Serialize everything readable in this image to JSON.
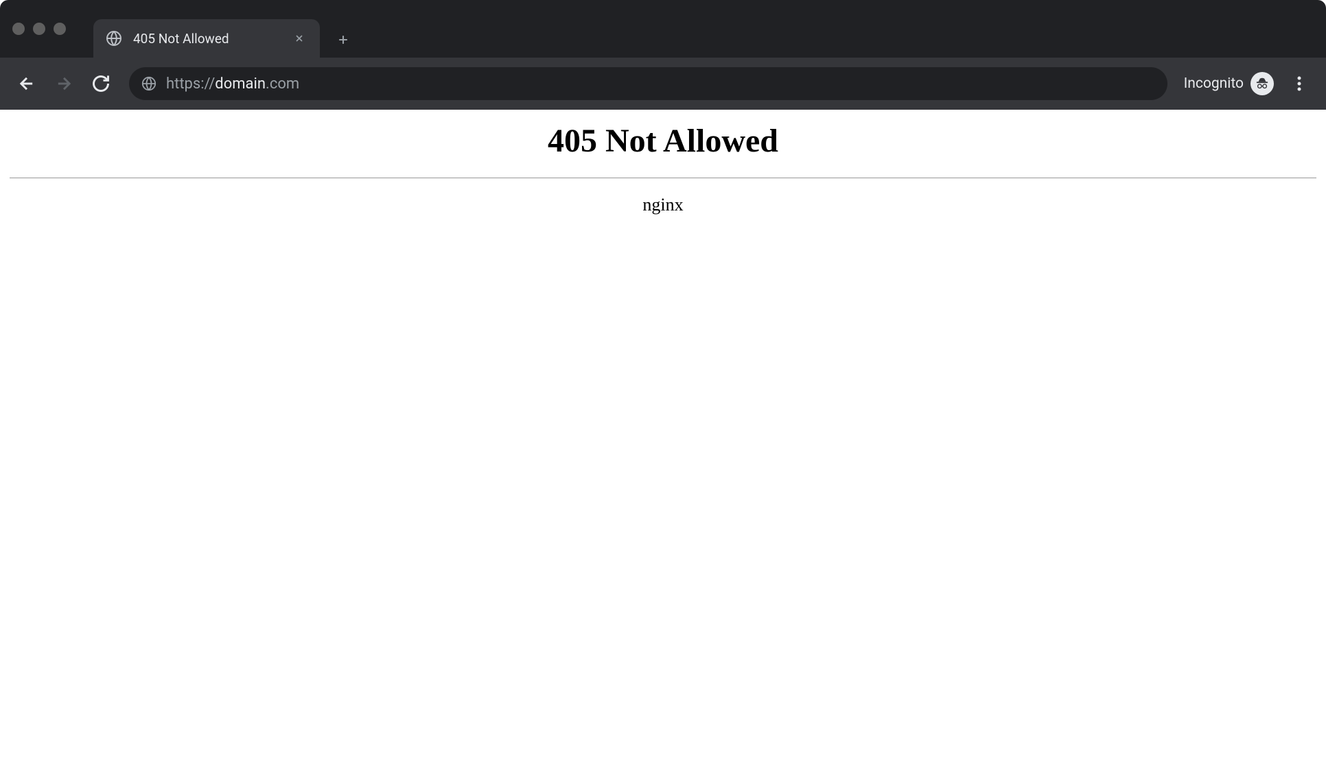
{
  "browser": {
    "tab": {
      "title": "405 Not Allowed"
    },
    "toolbar": {
      "url_scheme": "https://",
      "url_host": "domain",
      "url_tld": ".com",
      "incognito_label": "Incognito"
    }
  },
  "page": {
    "heading": "405 Not Allowed",
    "server": "nginx"
  }
}
